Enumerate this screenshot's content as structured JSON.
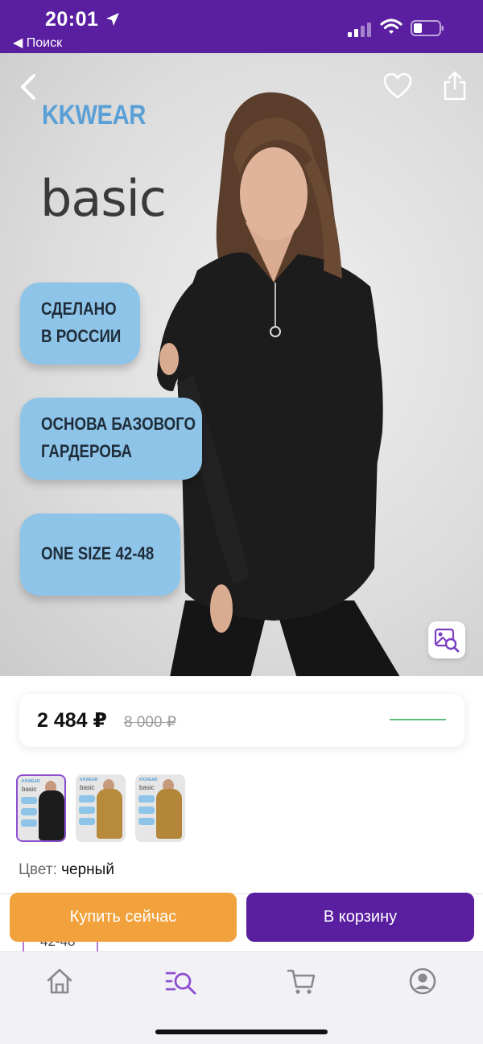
{
  "status_bar": {
    "time": "20:01",
    "back_label": "◀ Поиск",
    "icons": [
      "location-arrow-icon",
      "signal-icon",
      "wifi-icon",
      "battery-icon"
    ],
    "background": "#5a1ea0"
  },
  "product_image": {
    "brand": "KKWEAR",
    "line": "basic",
    "badges": [
      {
        "line1": "СДЕЛАНО",
        "line2": "В РОССИИ"
      },
      {
        "line1": "ОСНОВА БАЗОВОГО",
        "line2": "ГАРДЕРОБА"
      },
      {
        "line1": "ONE SIZE 42-48",
        "line2": ""
      }
    ],
    "badge_color": "#8ec4e8",
    "brand_color": "#5aa0d6"
  },
  "header_icons": [
    "back-chevron-icon",
    "heart-icon",
    "share-icon",
    "image-search-icon"
  ],
  "price": {
    "current": "2 484 ₽",
    "old": "8 000 ₽",
    "accent": "#5cc07a"
  },
  "thumbnails": [
    {
      "color": "black",
      "selected": true
    },
    {
      "color": "mustard",
      "selected": false
    },
    {
      "color": "mustard",
      "selected": false
    }
  ],
  "color": {
    "label": "Цвет:",
    "value": "черный"
  },
  "size_chip": {
    "label": "42-48"
  },
  "actions": {
    "buy_now": "Купить сейчас",
    "add_to_cart": "В корзину",
    "buy_color": "#f2a23c",
    "cart_color": "#5a1ea0"
  },
  "tab_bar": {
    "tabs": [
      "home-icon",
      "catalog-search-icon",
      "cart-icon",
      "profile-icon"
    ],
    "active_index": 1,
    "active_color": "#8d4fd0"
  }
}
